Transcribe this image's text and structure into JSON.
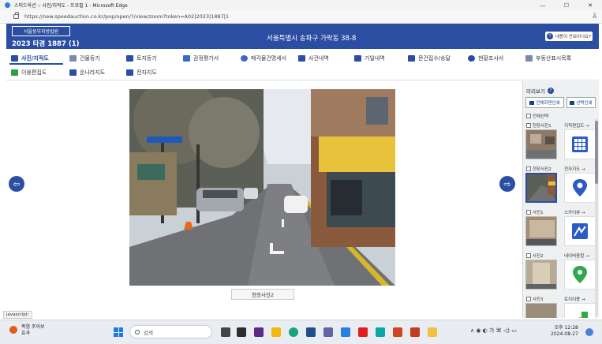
{
  "window": {
    "title": "스피드옥션 :: 사진/지적도 - 프로필 1 - Microsoft Edge",
    "controls": {
      "minimize": "—",
      "maximize": "☐",
      "close": "✕"
    }
  },
  "browser": {
    "url": "https://new.speedauction.co.kr/pop/open/?/view/zoom?token=A02|2023|1887|1",
    "reader_glyph": "A̅"
  },
  "header": {
    "court_button": "서울동부지방법원",
    "case_number": "2023 타경 1887 (1)",
    "address": "서울특별시 송파구 가락동 38-8",
    "help_label": "내용이 안보이나요?",
    "help_glyph": "?"
  },
  "tabs": [
    {
      "label": "사진/지적도",
      "icon": "photo-icon",
      "color": "#2b4ea2"
    },
    {
      "label": "건물등기",
      "icon": "document-icon",
      "color": "#7a8aa8"
    },
    {
      "label": "토지등기",
      "icon": "land-icon",
      "color": "#2b4ea2"
    },
    {
      "label": "감정평가서",
      "icon": "appraisal-icon",
      "color": "#3a68c2"
    },
    {
      "label": "매각물건명세서",
      "icon": "sale-icon",
      "color": "#3a68c2"
    },
    {
      "label": "사건내역",
      "icon": "case-icon",
      "color": "#2b4ea2"
    },
    {
      "label": "기일내역",
      "icon": "calendar-icon",
      "color": "#2b4ea2"
    },
    {
      "label": "문건접수/송달",
      "icon": "file-icon",
      "color": "#2b4ea2"
    },
    {
      "label": "현황조사서",
      "icon": "survey-icon",
      "color": "#2b4ea2"
    },
    {
      "label": "부동산표시목록",
      "icon": "list-icon",
      "color": "#7a8aa8"
    },
    {
      "label": "이용편집도",
      "icon": "grid-icon",
      "color": "#2f9e44"
    },
    {
      "label": "온나라지도",
      "icon": "map-icon",
      "color": "#2b4ea2"
    },
    {
      "label": "전자지도",
      "icon": "emap-icon",
      "color": "#2b4ea2"
    }
  ],
  "viewer": {
    "caption": "현장사진2",
    "prev_glyph": "⇦",
    "next_glyph": "⇨"
  },
  "panel": {
    "title": "미리보기",
    "help_glyph": "?",
    "print_all": "전체화면인쇄",
    "print_selected": "선택인쇄",
    "select_all": "전체선택",
    "items": [
      {
        "label": "현장사진1",
        "link": "지적편집도 →"
      },
      {
        "label": "현장사진2",
        "link": "전자지도 →"
      },
      {
        "label": "사진1",
        "link": "스카이뷰 →"
      },
      {
        "label": "사진2",
        "link": "네이버종합 →"
      },
      {
        "label": "사진3",
        "link": "토지이용 →"
      }
    ]
  },
  "status": {
    "text": "javascript:"
  },
  "taskbar": {
    "weather_title": "폭염 주의보",
    "weather_sub": "효과",
    "weather_badge": "1",
    "search_placeholder": "검색",
    "tray": "∧  ◉  ◐  가  ⌘  ◁)  ▭",
    "time": "오후 12:28",
    "date": "2024-08-27"
  }
}
